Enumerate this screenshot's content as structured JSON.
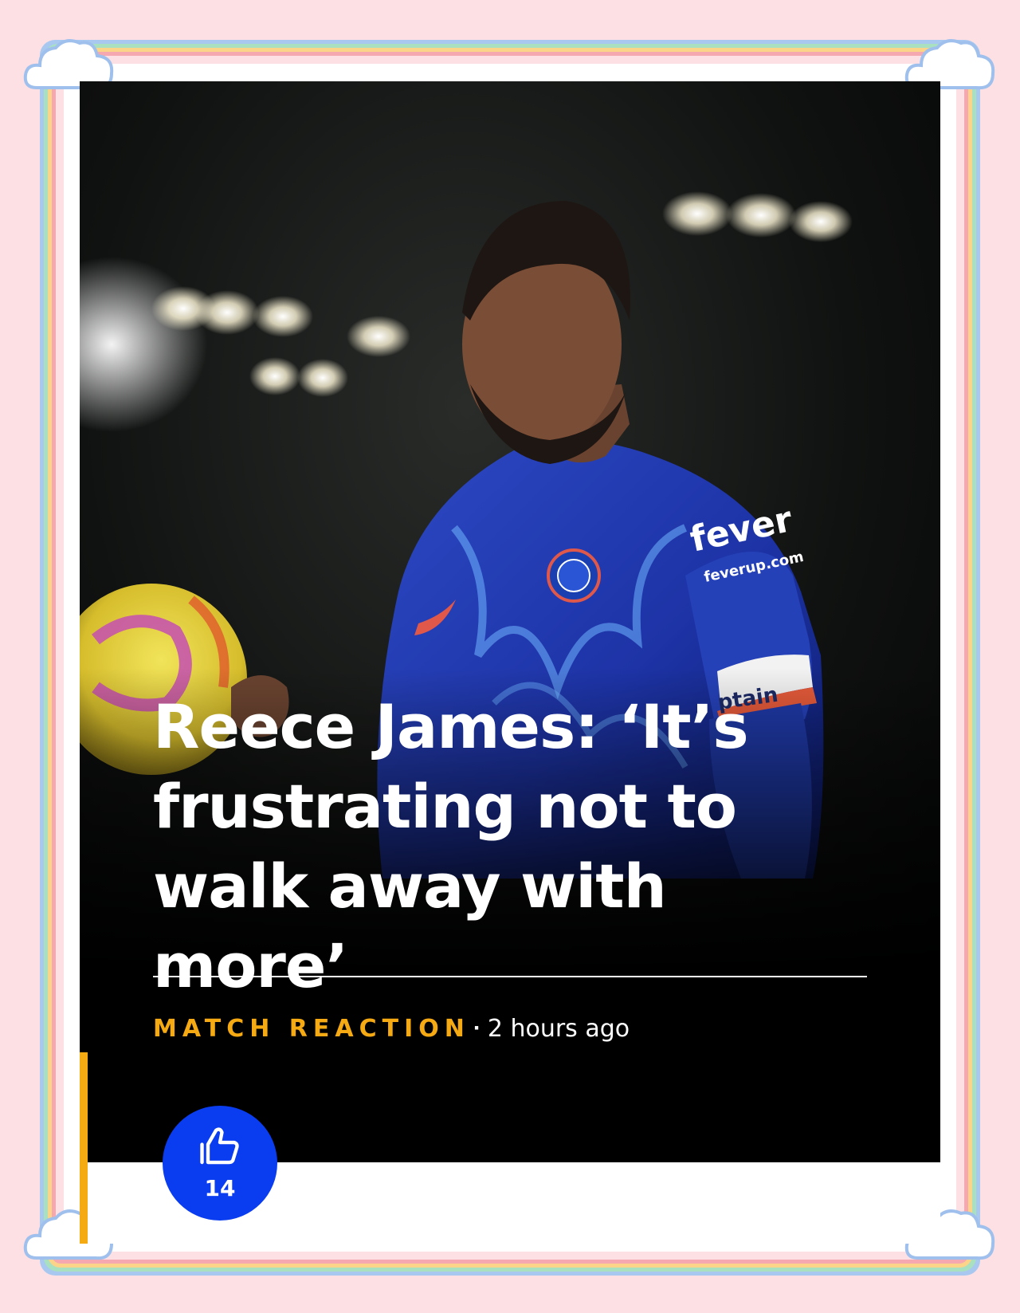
{
  "article": {
    "headline": "Reece James: ‘It’s frustrating not to walk away with more’",
    "category": "MATCH REACTION",
    "separator": "·",
    "timestamp": "2 hours ago",
    "image_subject": "Reece James holding a match ball under stadium floodlights",
    "kit_text": {
      "sponsor": "fever",
      "sponsor_url": "feverup.com",
      "armband": "ptain"
    }
  },
  "reactions": {
    "like_count": "14",
    "icon": "thumbs-up-icon"
  },
  "colors": {
    "background": "#fde0e4",
    "accent": "#f5a912",
    "like_button": "#0a3df0",
    "hero_background": "#000000",
    "headline_text": "#ffffff"
  }
}
